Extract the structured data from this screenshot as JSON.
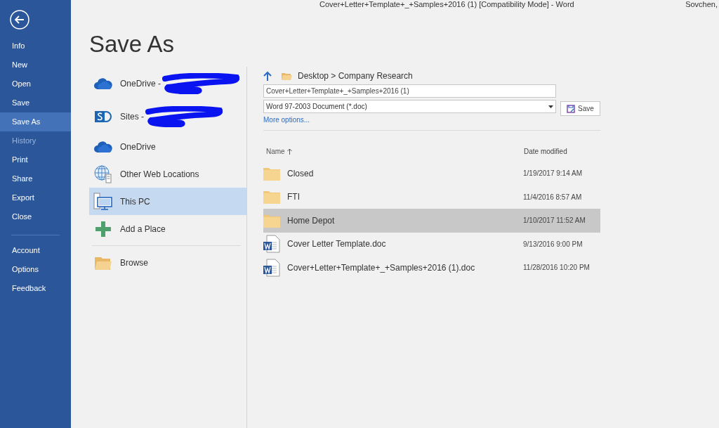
{
  "window": {
    "title": "Cover+Letter+Template+_+Samples+2016 (1) [Compatibility Mode] - Word",
    "user": "Sovchen,"
  },
  "sidebar": {
    "groups": [
      [
        {
          "label": "Info",
          "selected": false,
          "disabled": false
        },
        {
          "label": "New",
          "selected": false,
          "disabled": false
        },
        {
          "label": "Open",
          "selected": false,
          "disabled": false
        },
        {
          "label": "Save",
          "selected": false,
          "disabled": false
        },
        {
          "label": "Save As",
          "selected": true,
          "disabled": false
        },
        {
          "label": "History",
          "selected": false,
          "disabled": true
        },
        {
          "label": "Print",
          "selected": false,
          "disabled": false
        },
        {
          "label": "Share",
          "selected": false,
          "disabled": false
        },
        {
          "label": "Export",
          "selected": false,
          "disabled": false
        },
        {
          "label": "Close",
          "selected": false,
          "disabled": false
        }
      ],
      [
        {
          "label": "Account",
          "selected": false,
          "disabled": false
        },
        {
          "label": "Options",
          "selected": false,
          "disabled": false
        },
        {
          "label": "Feedback",
          "selected": false,
          "disabled": false
        }
      ]
    ]
  },
  "page_title": "Save As",
  "places": [
    [
      {
        "label": "OneDrive -",
        "kind": "cloud",
        "redacted": true,
        "selected": false
      },
      {
        "label": "Sites -",
        "kind": "sites",
        "redacted": true,
        "selected": false
      },
      {
        "label": "OneDrive",
        "kind": "cloud",
        "redacted": false,
        "selected": false
      },
      {
        "label": "Other Web Locations",
        "kind": "globe",
        "redacted": false,
        "selected": false
      },
      {
        "label": "This PC",
        "kind": "pc",
        "redacted": false,
        "selected": true
      },
      {
        "label": "Add a Place",
        "kind": "add",
        "redacted": false,
        "selected": false
      }
    ],
    [
      {
        "label": "Browse",
        "kind": "folder",
        "redacted": false,
        "selected": false
      }
    ]
  ],
  "location": "Desktop > Company Research",
  "file_name": {
    "value": "Cover+Letter+Template+_+Samples+2016 (1)"
  },
  "file_type": {
    "value": "Word 97-2003 Document (*.doc)"
  },
  "save_button": "Save",
  "more_options": "More options...",
  "file_list": {
    "columns": [
      "Name",
      "Date modified"
    ],
    "rows": [
      {
        "name": "Closed",
        "date": "1/19/2017 9:14 AM",
        "kind": "folder",
        "selected": false
      },
      {
        "name": "FTI",
        "date": "11/4/2016 8:57 AM",
        "kind": "folder",
        "selected": false
      },
      {
        "name": "Home Depot",
        "date": "1/10/2017 11:52 AM",
        "kind": "folder",
        "selected": true
      },
      {
        "name": "Cover Letter Template.doc",
        "date": "9/13/2016 9:00 PM",
        "kind": "word",
        "selected": false
      },
      {
        "name": "Cover+Letter+Template+_+Samples+2016 (1).doc",
        "date": "11/28/2016 10:20 PM",
        "kind": "word",
        "selected": false
      }
    ]
  }
}
